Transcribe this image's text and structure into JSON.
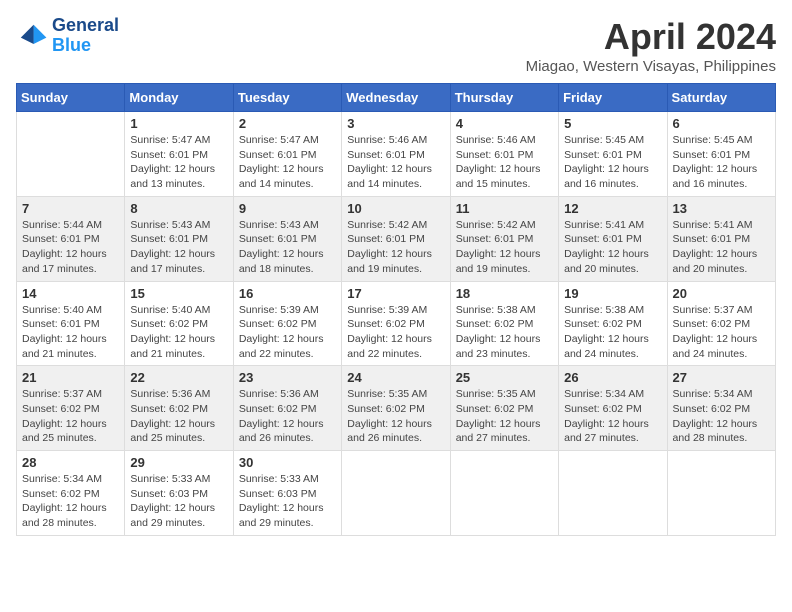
{
  "logo": {
    "line1": "General",
    "line2": "Blue"
  },
  "title": "April 2024",
  "subtitle": "Miagao, Western Visayas, Philippines",
  "days_of_week": [
    "Sunday",
    "Monday",
    "Tuesday",
    "Wednesday",
    "Thursday",
    "Friday",
    "Saturday"
  ],
  "weeks": [
    [
      {
        "num": "",
        "info": ""
      },
      {
        "num": "1",
        "info": "Sunrise: 5:47 AM\nSunset: 6:01 PM\nDaylight: 12 hours\nand 13 minutes."
      },
      {
        "num": "2",
        "info": "Sunrise: 5:47 AM\nSunset: 6:01 PM\nDaylight: 12 hours\nand 14 minutes."
      },
      {
        "num": "3",
        "info": "Sunrise: 5:46 AM\nSunset: 6:01 PM\nDaylight: 12 hours\nand 14 minutes."
      },
      {
        "num": "4",
        "info": "Sunrise: 5:46 AM\nSunset: 6:01 PM\nDaylight: 12 hours\nand 15 minutes."
      },
      {
        "num": "5",
        "info": "Sunrise: 5:45 AM\nSunset: 6:01 PM\nDaylight: 12 hours\nand 16 minutes."
      },
      {
        "num": "6",
        "info": "Sunrise: 5:45 AM\nSunset: 6:01 PM\nDaylight: 12 hours\nand 16 minutes."
      }
    ],
    [
      {
        "num": "7",
        "info": "Sunrise: 5:44 AM\nSunset: 6:01 PM\nDaylight: 12 hours\nand 17 minutes."
      },
      {
        "num": "8",
        "info": "Sunrise: 5:43 AM\nSunset: 6:01 PM\nDaylight: 12 hours\nand 17 minutes."
      },
      {
        "num": "9",
        "info": "Sunrise: 5:43 AM\nSunset: 6:01 PM\nDaylight: 12 hours\nand 18 minutes."
      },
      {
        "num": "10",
        "info": "Sunrise: 5:42 AM\nSunset: 6:01 PM\nDaylight: 12 hours\nand 19 minutes."
      },
      {
        "num": "11",
        "info": "Sunrise: 5:42 AM\nSunset: 6:01 PM\nDaylight: 12 hours\nand 19 minutes."
      },
      {
        "num": "12",
        "info": "Sunrise: 5:41 AM\nSunset: 6:01 PM\nDaylight: 12 hours\nand 20 minutes."
      },
      {
        "num": "13",
        "info": "Sunrise: 5:41 AM\nSunset: 6:01 PM\nDaylight: 12 hours\nand 20 minutes."
      }
    ],
    [
      {
        "num": "14",
        "info": "Sunrise: 5:40 AM\nSunset: 6:01 PM\nDaylight: 12 hours\nand 21 minutes."
      },
      {
        "num": "15",
        "info": "Sunrise: 5:40 AM\nSunset: 6:02 PM\nDaylight: 12 hours\nand 21 minutes."
      },
      {
        "num": "16",
        "info": "Sunrise: 5:39 AM\nSunset: 6:02 PM\nDaylight: 12 hours\nand 22 minutes."
      },
      {
        "num": "17",
        "info": "Sunrise: 5:39 AM\nSunset: 6:02 PM\nDaylight: 12 hours\nand 22 minutes."
      },
      {
        "num": "18",
        "info": "Sunrise: 5:38 AM\nSunset: 6:02 PM\nDaylight: 12 hours\nand 23 minutes."
      },
      {
        "num": "19",
        "info": "Sunrise: 5:38 AM\nSunset: 6:02 PM\nDaylight: 12 hours\nand 24 minutes."
      },
      {
        "num": "20",
        "info": "Sunrise: 5:37 AM\nSunset: 6:02 PM\nDaylight: 12 hours\nand 24 minutes."
      }
    ],
    [
      {
        "num": "21",
        "info": "Sunrise: 5:37 AM\nSunset: 6:02 PM\nDaylight: 12 hours\nand 25 minutes."
      },
      {
        "num": "22",
        "info": "Sunrise: 5:36 AM\nSunset: 6:02 PM\nDaylight: 12 hours\nand 25 minutes."
      },
      {
        "num": "23",
        "info": "Sunrise: 5:36 AM\nSunset: 6:02 PM\nDaylight: 12 hours\nand 26 minutes."
      },
      {
        "num": "24",
        "info": "Sunrise: 5:35 AM\nSunset: 6:02 PM\nDaylight: 12 hours\nand 26 minutes."
      },
      {
        "num": "25",
        "info": "Sunrise: 5:35 AM\nSunset: 6:02 PM\nDaylight: 12 hours\nand 27 minutes."
      },
      {
        "num": "26",
        "info": "Sunrise: 5:34 AM\nSunset: 6:02 PM\nDaylight: 12 hours\nand 27 minutes."
      },
      {
        "num": "27",
        "info": "Sunrise: 5:34 AM\nSunset: 6:02 PM\nDaylight: 12 hours\nand 28 minutes."
      }
    ],
    [
      {
        "num": "28",
        "info": "Sunrise: 5:34 AM\nSunset: 6:02 PM\nDaylight: 12 hours\nand 28 minutes."
      },
      {
        "num": "29",
        "info": "Sunrise: 5:33 AM\nSunset: 6:03 PM\nDaylight: 12 hours\nand 29 minutes."
      },
      {
        "num": "30",
        "info": "Sunrise: 5:33 AM\nSunset: 6:03 PM\nDaylight: 12 hours\nand 29 minutes."
      },
      {
        "num": "",
        "info": ""
      },
      {
        "num": "",
        "info": ""
      },
      {
        "num": "",
        "info": ""
      },
      {
        "num": "",
        "info": ""
      }
    ]
  ]
}
